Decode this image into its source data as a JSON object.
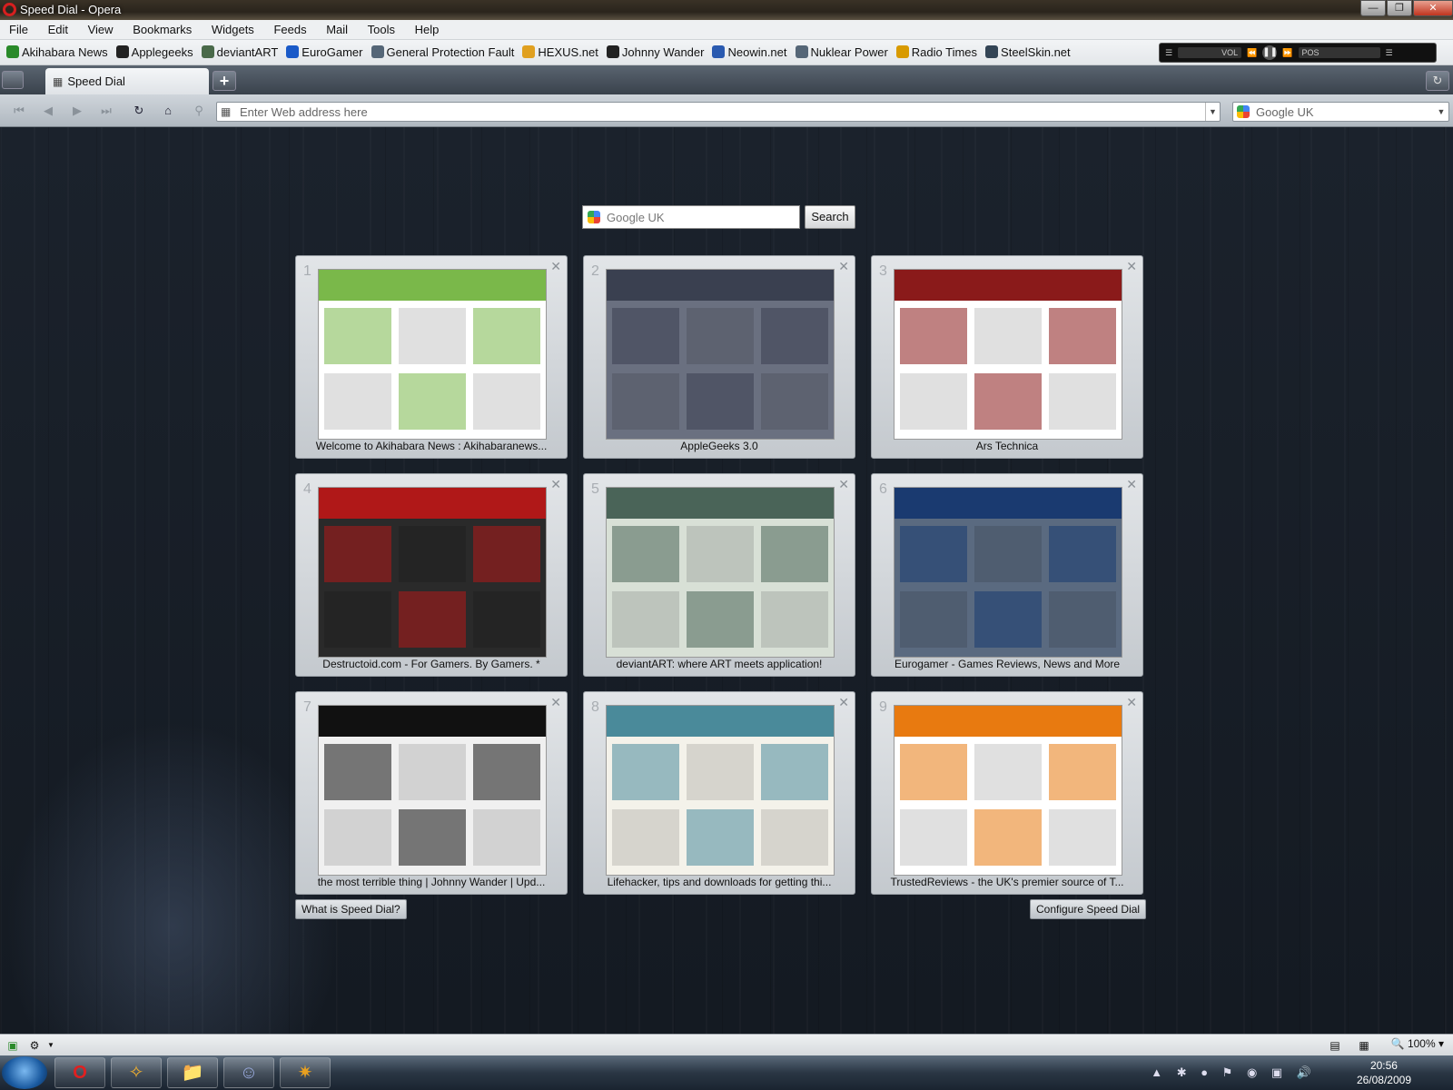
{
  "window": {
    "title": "Speed Dial - Opera"
  },
  "menu": [
    "File",
    "Edit",
    "View",
    "Bookmarks",
    "Widgets",
    "Feeds",
    "Mail",
    "Tools",
    "Help"
  ],
  "bookmarks": [
    {
      "label": "Akihabara News",
      "icon": "akihabara-icon",
      "color": "#2a8a2a"
    },
    {
      "label": "Applegeeks",
      "icon": "power-icon",
      "color": "#222222"
    },
    {
      "label": "deviantART",
      "icon": "deviantart-icon",
      "color": "#4a6a4a"
    },
    {
      "label": "EuroGamer",
      "icon": "eurogamer-icon",
      "color": "#1a5ac8"
    },
    {
      "label": "General Protection Fault",
      "icon": "star-icon",
      "color": "#556677"
    },
    {
      "label": "HEXUS.net",
      "icon": "hexus-icon",
      "color": "#e0a020"
    },
    {
      "label": "Johnny Wander",
      "icon": "bird-icon",
      "color": "#222222"
    },
    {
      "label": "Neowin.net",
      "icon": "neowin-icon",
      "color": "#2a5ab0"
    },
    {
      "label": "Nuklear Power",
      "icon": "star-icon",
      "color": "#556677"
    },
    {
      "label": "Radio Times",
      "icon": "rt-icon",
      "color": "#d89a00"
    },
    {
      "label": "SteelSkin.net",
      "icon": "steelskin-icon",
      "color": "#334455"
    }
  ],
  "media_player": {
    "vol": "VOL",
    "pos": "POS"
  },
  "tab": {
    "label": "Speed Dial"
  },
  "address": {
    "placeholder": "Enter Web address here"
  },
  "search_engine": "Google UK",
  "speed_dial": {
    "search_placeholder": "Google UK",
    "search_button": "Search",
    "what_is": "What is Speed Dial?",
    "configure": "Configure Speed Dial",
    "dials": [
      {
        "num": "1",
        "caption": "Welcome to Akihabara News : Akihabaranews...",
        "theme": "#7ab84a",
        "bg": "#ffffff"
      },
      {
        "num": "2",
        "caption": "AppleGeeks 3.0",
        "theme": "#3a4050",
        "bg": "#6a7080"
      },
      {
        "num": "3",
        "caption": "Ars Technica",
        "theme": "#8a1a1a",
        "bg": "#ffffff"
      },
      {
        "num": "4",
        "caption": "Destructoid.com - For Gamers. By Gamers. *",
        "theme": "#b01818",
        "bg": "#2a2a2a"
      },
      {
        "num": "5",
        "caption": "deviantART: where ART meets application!",
        "theme": "#4a6458",
        "bg": "#d8e0d6"
      },
      {
        "num": "6",
        "caption": "Eurogamer - Games Reviews, News and More",
        "theme": "#1a3a70",
        "bg": "#5a6a80"
      },
      {
        "num": "7",
        "caption": "the most terrible thing | Johnny Wander | Upd...",
        "theme": "#111111",
        "bg": "#f0f0f0"
      },
      {
        "num": "8",
        "caption": "Lifehacker, tips and downloads for getting thi...",
        "theme": "#4a8a9a",
        "bg": "#f4f2ea"
      },
      {
        "num": "9",
        "caption": "TrustedReviews - the UK's premier source of T...",
        "theme": "#e87a10",
        "bg": "#ffffff"
      }
    ]
  },
  "status": {
    "zoom": "100%"
  },
  "clock": {
    "time": "20:56",
    "date": "26/08/2009"
  }
}
